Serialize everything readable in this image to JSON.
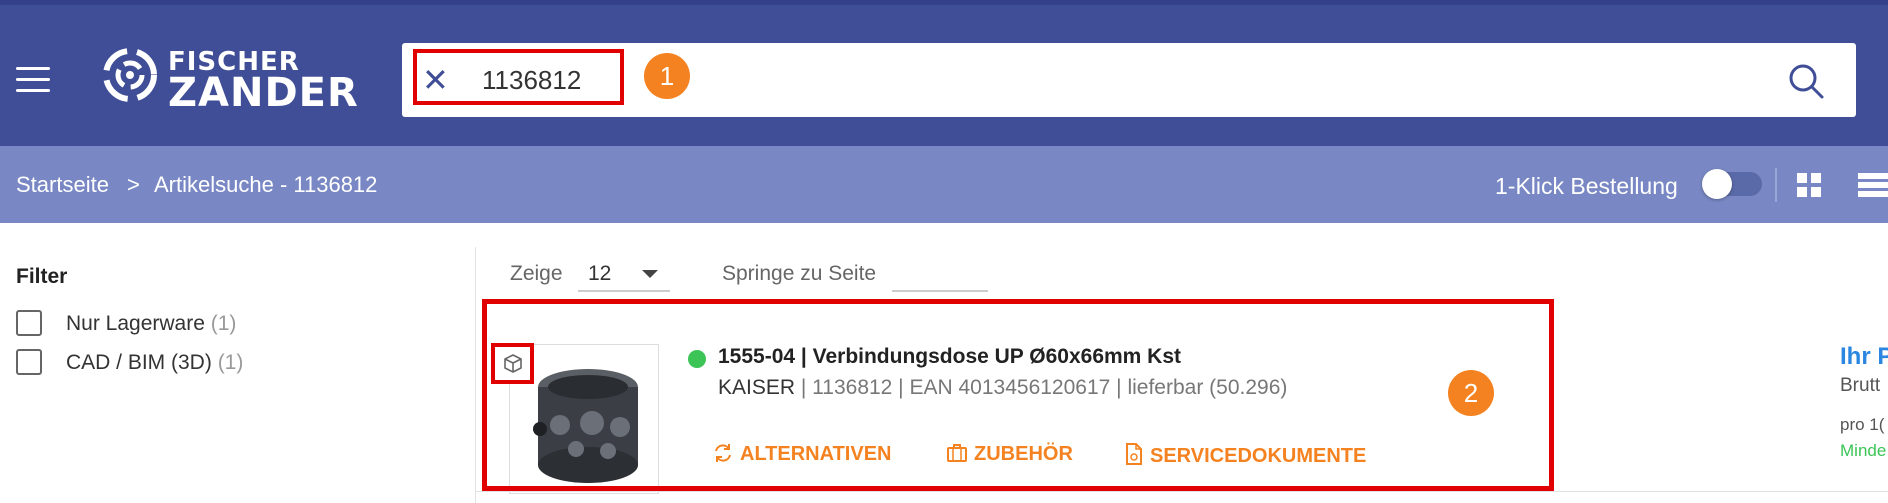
{
  "header": {
    "logo_line1": "FISCHER",
    "logo_line2": "ZANDER",
    "search_value": "1136812",
    "brand_color": "#3f4e96"
  },
  "annotations": {
    "badge1": "1",
    "badge2": "2",
    "highlight_color": "#e00000",
    "badge_color": "#f58220"
  },
  "breadcrumb": {
    "home": "Startseite",
    "separator": ">",
    "current": "Artikelsuche - 1136812"
  },
  "toolbar": {
    "one_click_label": "1-Klick Bestellung",
    "one_click_on": false
  },
  "filter": {
    "title": "Filter",
    "options": [
      {
        "label": "Nur Lagerware",
        "count": "(1)"
      },
      {
        "label": "CAD / BIM (3D)",
        "count": "(1)"
      }
    ]
  },
  "pagination": {
    "zeige_label": "Zeige",
    "zeige_value": "12",
    "springe_label": "Springe zu Seite",
    "springe_value": ""
  },
  "product": {
    "title": "1555-04 | Verbindungsdose UP Ø60x66mm Kst",
    "brand": "KAISER",
    "meta": " | 1136812 | EAN 4013456120617 | lieferbar (50.296)",
    "availability_color": "#3cc456",
    "actions": {
      "alternatives": "ALTERNATIVEN",
      "accessories": "ZUBEHÖR",
      "documents": "SERVICEDOKUMENTE"
    },
    "price_link": "Ihr P",
    "price_sub": "Brutt",
    "price_unit": "pro 1(",
    "price_min": "Minde"
  }
}
